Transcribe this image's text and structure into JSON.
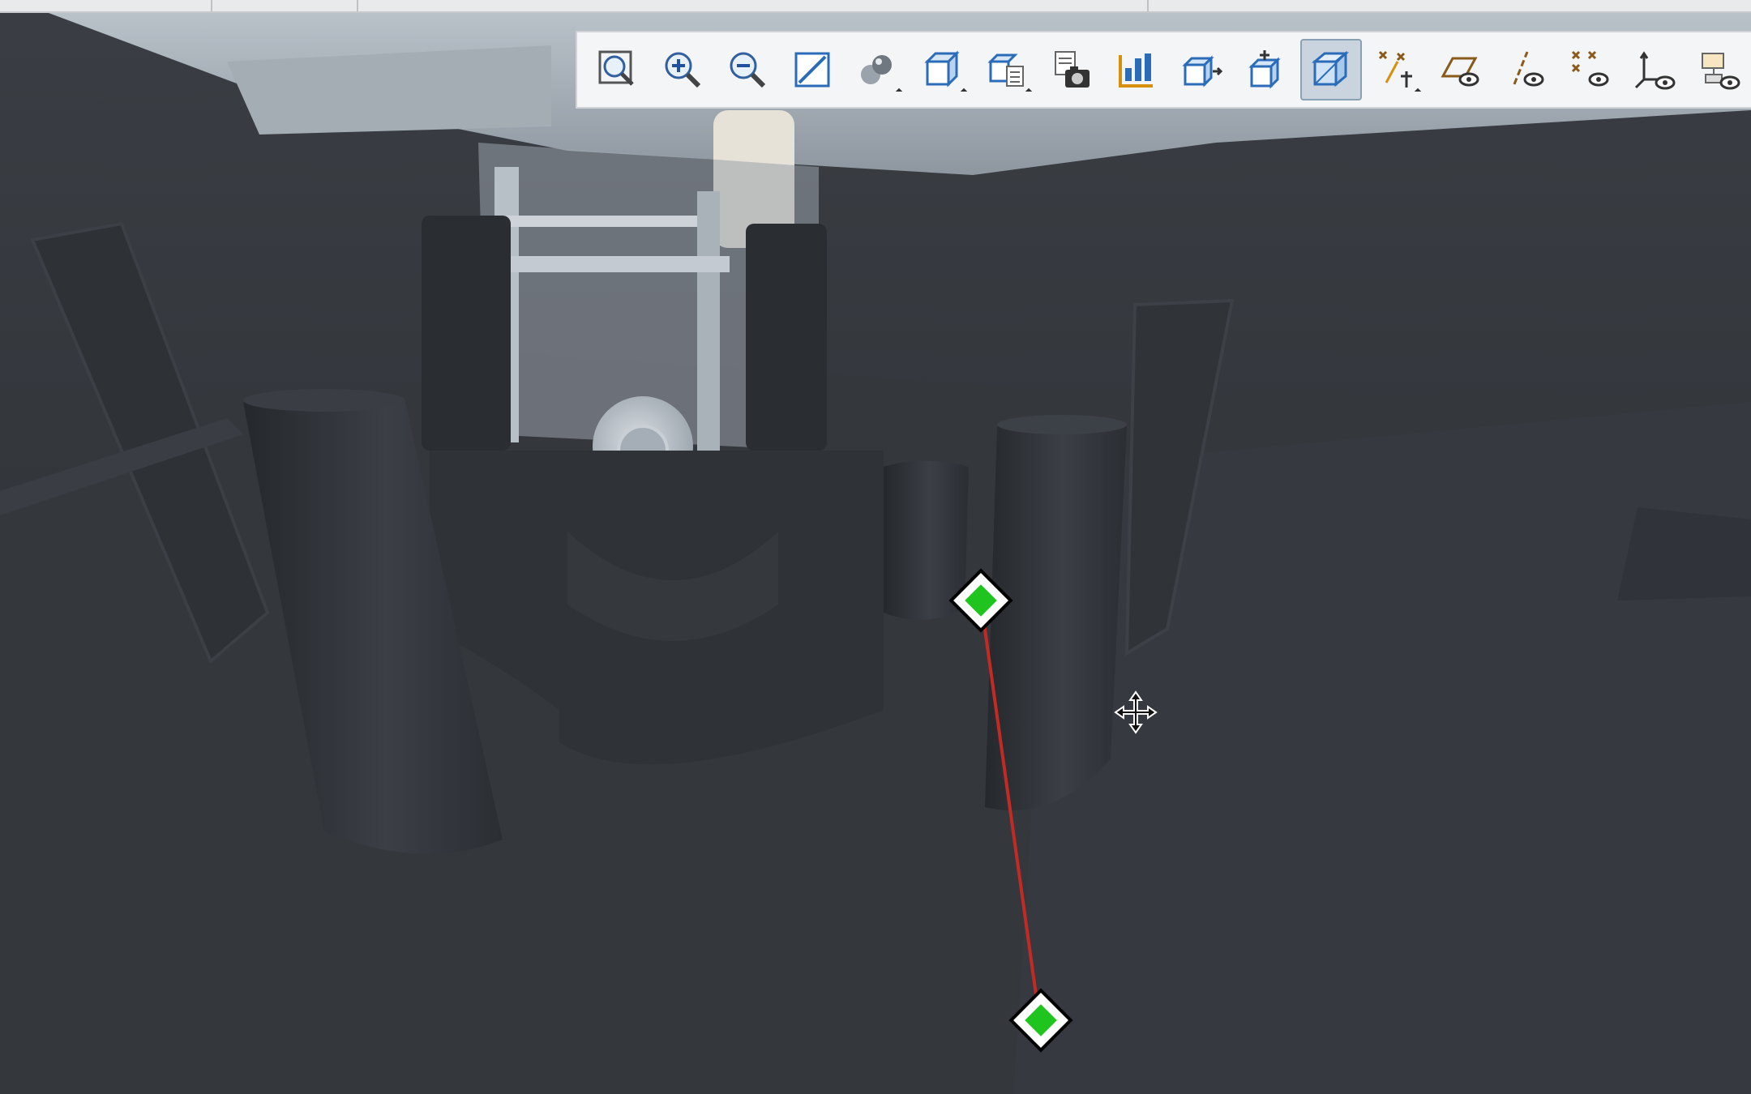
{
  "toolbar": {
    "buttons": [
      {
        "id": "zoom-fit",
        "icon": "magnifier-fit-icon"
      },
      {
        "id": "zoom-in",
        "icon": "magnifier-plus-icon"
      },
      {
        "id": "zoom-out",
        "icon": "magnifier-minus-icon"
      },
      {
        "id": "zoom-area",
        "icon": "zoom-area-icon"
      },
      {
        "id": "display-style",
        "icon": "shading-spheres-icon",
        "dropdown": true
      },
      {
        "id": "named-views",
        "icon": "cube-view-icon",
        "dropdown": true
      },
      {
        "id": "saved-orientations",
        "icon": "cube-list-icon",
        "dropdown": true
      },
      {
        "id": "view-manager",
        "icon": "camera-list-icon"
      },
      {
        "id": "section",
        "icon": "section-bars-icon"
      },
      {
        "id": "perspective",
        "icon": "cube-arrow-icon"
      },
      {
        "id": "annotation-plane",
        "icon": "cube-plus-icon"
      },
      {
        "id": "spin-center",
        "icon": "cube-wire-icon",
        "active": true
      },
      {
        "id": "datum-display",
        "icon": "datum-axes-icon",
        "dropdown": true
      },
      {
        "id": "plane-display",
        "icon": "plane-eye-icon"
      },
      {
        "id": "axis-display",
        "icon": "axis-eye-icon"
      },
      {
        "id": "point-display",
        "icon": "points-eye-icon"
      },
      {
        "id": "csys-display",
        "icon": "csys-eye-icon"
      },
      {
        "id": "annotation-display",
        "icon": "annotation-eye-icon"
      }
    ]
  },
  "measure_line": {
    "color": "#c42a24",
    "handle_color": "#1fc41f"
  },
  "cursor": {
    "icon": "move-cursor-icon"
  }
}
